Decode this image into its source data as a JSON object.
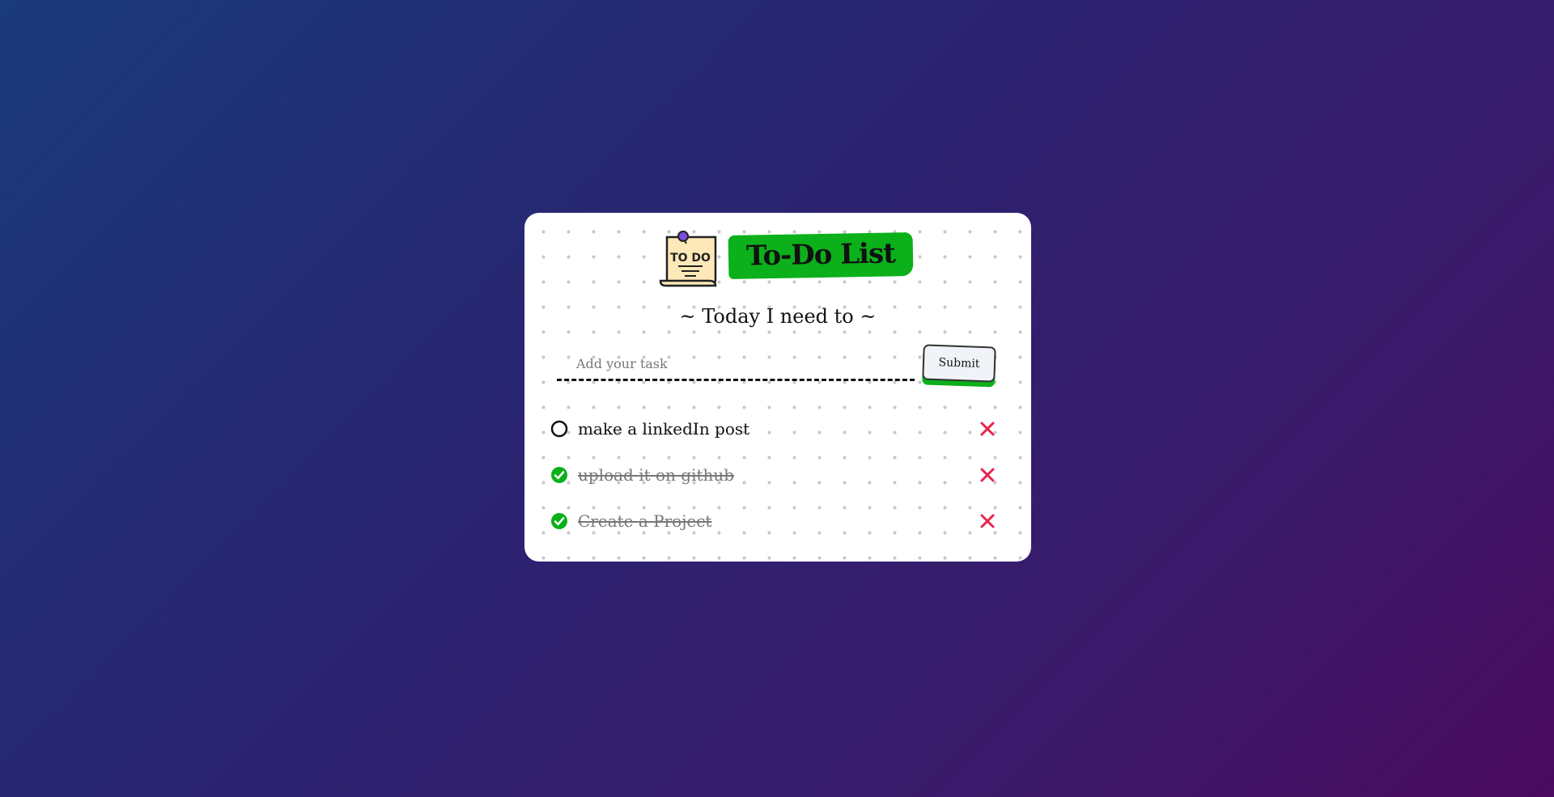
{
  "app": {
    "title": "To-Do List",
    "logo_text": "TO DO",
    "subtitle": "~ Today I need to ~"
  },
  "input": {
    "placeholder": "Add your task",
    "value": "",
    "submit_label": "Submit"
  },
  "tasks": [
    {
      "text": "make a linkedIn post",
      "done": false
    },
    {
      "text": "upload it on github",
      "done": true
    },
    {
      "text": "Create a Project",
      "done": true
    }
  ],
  "colors": {
    "accent": "#0bb01a",
    "delete": "#e8234a",
    "gradient_start": "#1a3a7a",
    "gradient_end": "#4a0a5e"
  }
}
